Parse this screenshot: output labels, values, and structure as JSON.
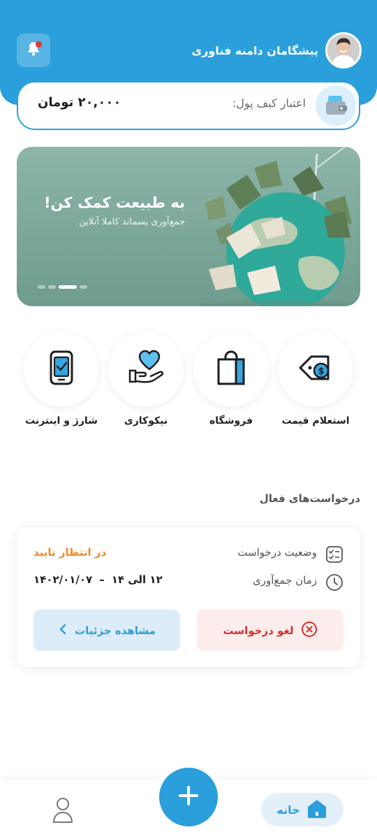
{
  "header": {
    "company_name": "پیشگامان دامنه فناوری"
  },
  "wallet": {
    "label": "اعتبار کیف پول:",
    "amount": "۲۰,۰۰۰ تومان"
  },
  "banner": {
    "title": "به طبیعت کمک کن!",
    "subtitle": "جمع‌آوری پسماند کاملا آنلاین",
    "slide_count": 4,
    "active_slide": 2
  },
  "services": [
    {
      "label": "استعلام قیمت",
      "icon": "price-tag-icon"
    },
    {
      "label": "فروشگاه",
      "icon": "shopping-bag-icon"
    },
    {
      "label": "نیکوکاری",
      "icon": "charity-heart-icon"
    },
    {
      "label": "شارژ و اینترنت",
      "icon": "mobile-charge-icon"
    }
  ],
  "active_requests": {
    "title": "درخواست‌های فعال",
    "status_label": "وضعیت درخواست",
    "status_value": "در انتظار تایید",
    "time_label": "زمان جمع‌آوری",
    "time_range": "۱۲ الی ۱۴",
    "date": "۱۴۰۲/۰۱/۰۷",
    "cancel_label": "لغو درخواست",
    "details_label": "مشاهده جزئیات"
  },
  "bottom_nav": {
    "home_label": "خانه"
  },
  "colors": {
    "primary": "#2a9fdc",
    "pending": "#f08a24",
    "danger": "#d32f2f",
    "notification": "#e53935"
  }
}
